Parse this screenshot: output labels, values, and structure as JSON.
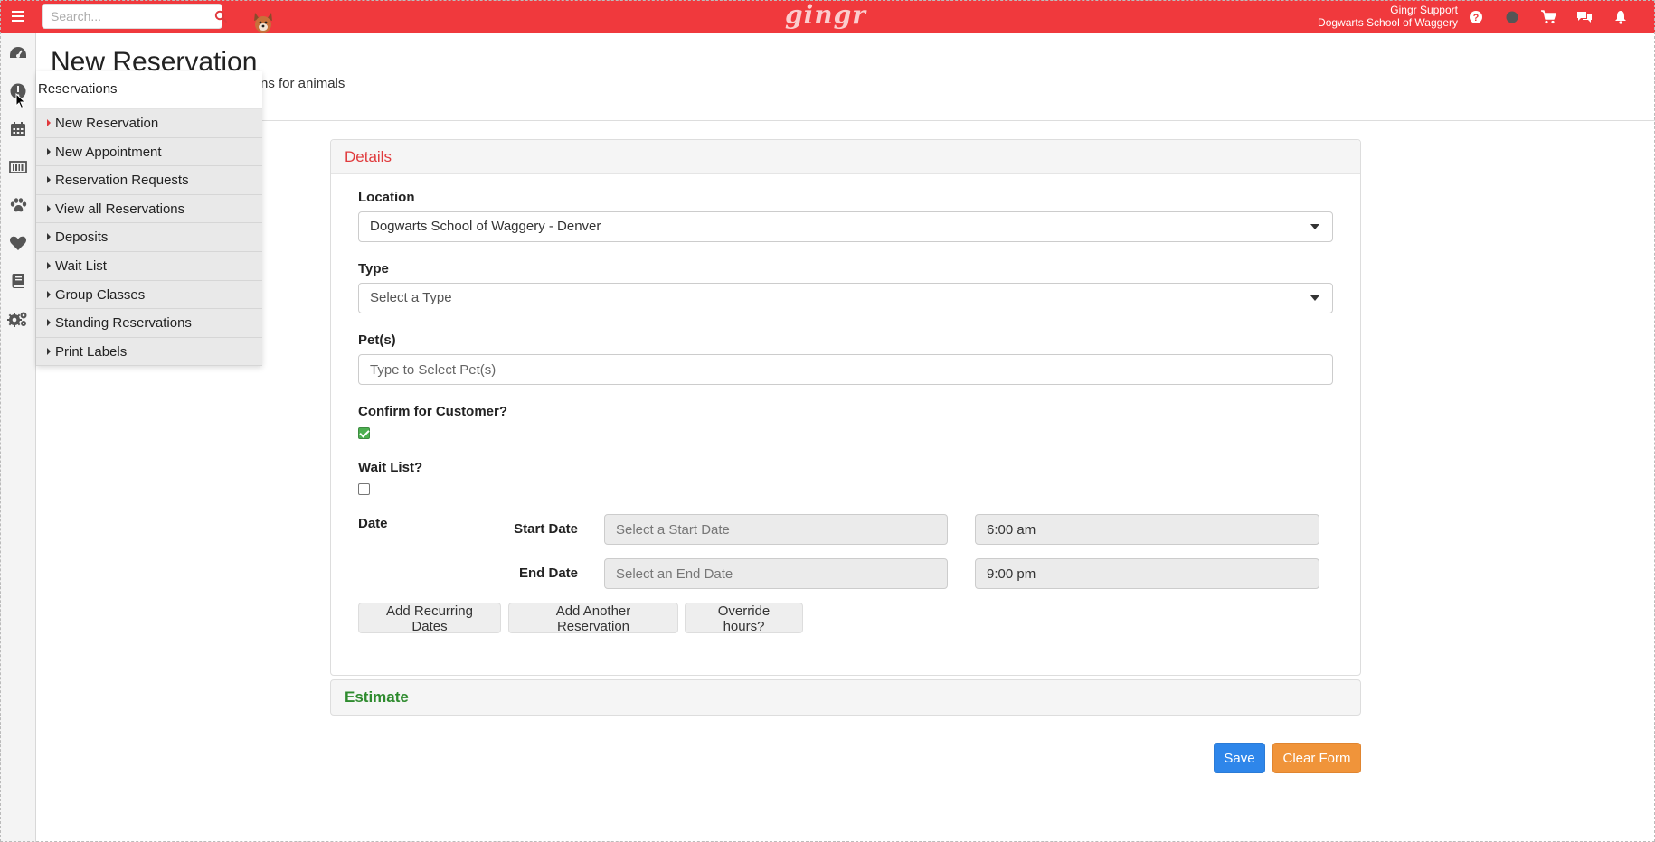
{
  "topbar": {
    "search_placeholder": "Search...",
    "logo": "gingr",
    "user_name": "Gingr Support",
    "org_name": "Dogwarts School of Waggery",
    "accent_color": "#f0393d"
  },
  "rail": {
    "icons": [
      "dashboard-icon",
      "reservations-icon",
      "calendar-icon",
      "barcode-icon",
      "paw-icon",
      "heart-icon",
      "book-icon",
      "settings-icon"
    ]
  },
  "page": {
    "title": "New Reservation",
    "subtitle": "ns for animals"
  },
  "flyout": {
    "title": "Reservations",
    "items": [
      {
        "label": "New Reservation"
      },
      {
        "label": "New Appointment"
      },
      {
        "label": "Reservation Requests"
      },
      {
        "label": "View all Reservations"
      },
      {
        "label": "Deposits"
      },
      {
        "label": "Wait List"
      },
      {
        "label": "Group Classes"
      },
      {
        "label": "Standing Reservations"
      },
      {
        "label": "Print Labels"
      }
    ]
  },
  "details": {
    "title": "Details",
    "location_label": "Location",
    "location_value": "Dogwarts School of Waggery - Denver",
    "type_label": "Type",
    "type_placeholder": "Select a Type",
    "pets_label": "Pet(s)",
    "pets_placeholder": "Type to Select Pet(s)",
    "confirm_label": "Confirm for Customer?",
    "confirm_checked": true,
    "waitlist_label": "Wait List?",
    "waitlist_checked": false,
    "date_label": "Date",
    "start_date_label": "Start Date",
    "start_date_placeholder": "Select a Start Date",
    "start_time": "6:00 am",
    "end_date_label": "End Date",
    "end_date_placeholder": "Select an End Date",
    "end_time": "9:00 pm",
    "btn_recurring": "Add Recurring Dates",
    "btn_another": "Add Another Reservation",
    "btn_override": "Override hours?"
  },
  "estimate": {
    "title": "Estimate"
  },
  "actions": {
    "save": "Save",
    "clear": "Clear Form"
  }
}
